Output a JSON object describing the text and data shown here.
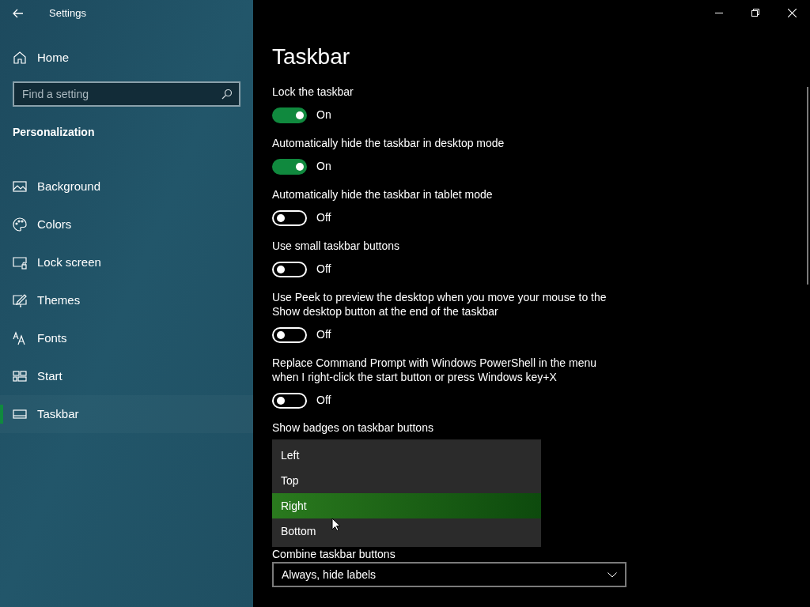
{
  "window": {
    "title": "Settings"
  },
  "sidebar": {
    "home": "Home",
    "search": {
      "placeholder": "Find a setting"
    },
    "section": "Personalization",
    "items": [
      {
        "label": "Background",
        "kind": "background",
        "selected": false
      },
      {
        "label": "Colors",
        "kind": "colors",
        "selected": false
      },
      {
        "label": "Lock screen",
        "kind": "lock",
        "selected": false
      },
      {
        "label": "Themes",
        "kind": "themes",
        "selected": false
      },
      {
        "label": "Fonts",
        "kind": "fonts",
        "selected": false
      },
      {
        "label": "Start",
        "kind": "start",
        "selected": false
      },
      {
        "label": "Taskbar",
        "kind": "taskbar",
        "selected": true
      }
    ]
  },
  "page": {
    "title": "Taskbar",
    "toggles": [
      {
        "label": "Lock the taskbar",
        "on": true,
        "state": "On"
      },
      {
        "label": "Automatically hide the taskbar in desktop mode",
        "on": true,
        "state": "On"
      },
      {
        "label": "Automatically hide the taskbar in tablet mode",
        "on": false,
        "state": "Off"
      },
      {
        "label": "Use small taskbar buttons",
        "on": false,
        "state": "Off"
      },
      {
        "label": "Use Peek to preview the desktop when you move your mouse to the Show desktop button at the end of the taskbar",
        "on": false,
        "state": "Off"
      },
      {
        "label": "Replace Command Prompt with Windows PowerShell in the menu when I right-click the start button or press Windows key+X",
        "on": false,
        "state": "Off"
      }
    ],
    "badges": {
      "label": "Show badges on taskbar buttons",
      "options": [
        {
          "label": "Left",
          "selected": false
        },
        {
          "label": "Top",
          "selected": false
        },
        {
          "label": "Right",
          "selected": true
        },
        {
          "label": "Bottom",
          "selected": false
        }
      ]
    },
    "combine": {
      "label": "Combine taskbar buttons",
      "value": "Always, hide labels"
    }
  }
}
